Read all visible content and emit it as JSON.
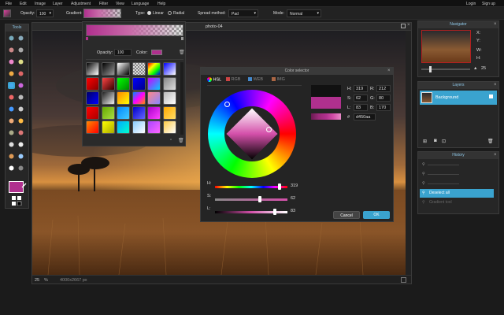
{
  "menu": {
    "items": [
      "File",
      "Edit",
      "Image",
      "Layer",
      "Adjustment",
      "Filter",
      "View",
      "Language",
      "Help"
    ],
    "login": "Login",
    "signup": "Sign up"
  },
  "options": {
    "opacity_label": "Opacity:",
    "opacity_value": "100",
    "gradient_label": "Gradient:",
    "type_label": "Type:",
    "type_linear": "Linear",
    "type_radial": "Radial",
    "spread_label": "Spread method:",
    "spread_value": "Pad",
    "mode_label": "Mode:",
    "mode_value": "Normal"
  },
  "tools": {
    "title": "Tools"
  },
  "document": {
    "title": "photo-04",
    "zoom": "25",
    "size": "4000x2667 px"
  },
  "gradient_panel": {
    "opacity_label": "Opacity:",
    "opacity_value": "100",
    "color_label": "Color:"
  },
  "color_selector": {
    "title": "Color selector",
    "tabs": [
      "HSL",
      "RGB",
      "WEB",
      "IMG"
    ],
    "sliders": [
      {
        "label": "H:",
        "value": "319",
        "fraction": 0.886
      },
      {
        "label": "S:",
        "value": "62",
        "fraction": 0.62
      },
      {
        "label": "L:",
        "value": "83",
        "fraction": 0.83
      }
    ],
    "fields": {
      "h_label": "H:",
      "h": "319",
      "r_label": "R:",
      "r": "212",
      "s_label": "S:",
      "s": "62",
      "g_label": "G:",
      "g": "80",
      "l_label": "L:",
      "l": "83",
      "b_label": "B:",
      "b": "170",
      "hex_label": "#",
      "hex": "d450aa"
    },
    "cancel": "Cancel",
    "ok": "OK",
    "selected_color": "#d450aa"
  },
  "navigator": {
    "title": "Navigator",
    "x_label": "X:",
    "y_label": "Y:",
    "w_label": "W:",
    "h_label": "H:",
    "zoom": "25"
  },
  "layers": {
    "title": "Layers",
    "items": [
      {
        "name": "Background"
      }
    ]
  },
  "history": {
    "title": "History",
    "items": [
      "",
      "",
      "",
      "Deselect all",
      "Gradient tool"
    ],
    "active_index": 3
  }
}
